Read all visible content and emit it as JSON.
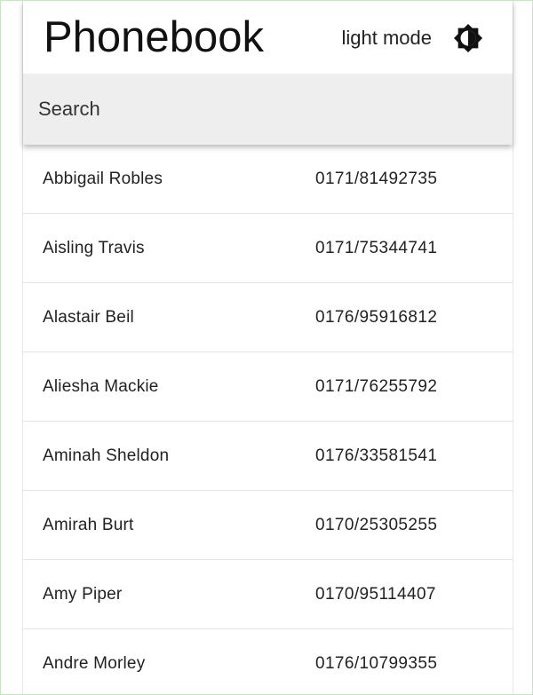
{
  "header": {
    "title": "Phonebook",
    "mode_label": "light mode",
    "mode_icon": "brightness-icon"
  },
  "search": {
    "placeholder": "Search",
    "value": ""
  },
  "contacts": [
    {
      "name": "Abbigail Robles",
      "phone": "0171/81492735"
    },
    {
      "name": "Aisling Travis",
      "phone": "0171/75344741"
    },
    {
      "name": "Alastair Beil",
      "phone": "0176/95916812"
    },
    {
      "name": "Aliesha Mackie",
      "phone": "0171/76255792"
    },
    {
      "name": "Aminah Sheldon",
      "phone": "0176/33581541"
    },
    {
      "name": "Amirah Burt",
      "phone": "0170/25305255"
    },
    {
      "name": "Amy Piper",
      "phone": "0170/95114407"
    },
    {
      "name": "Andre Morley",
      "phone": "0176/10799355"
    }
  ]
}
